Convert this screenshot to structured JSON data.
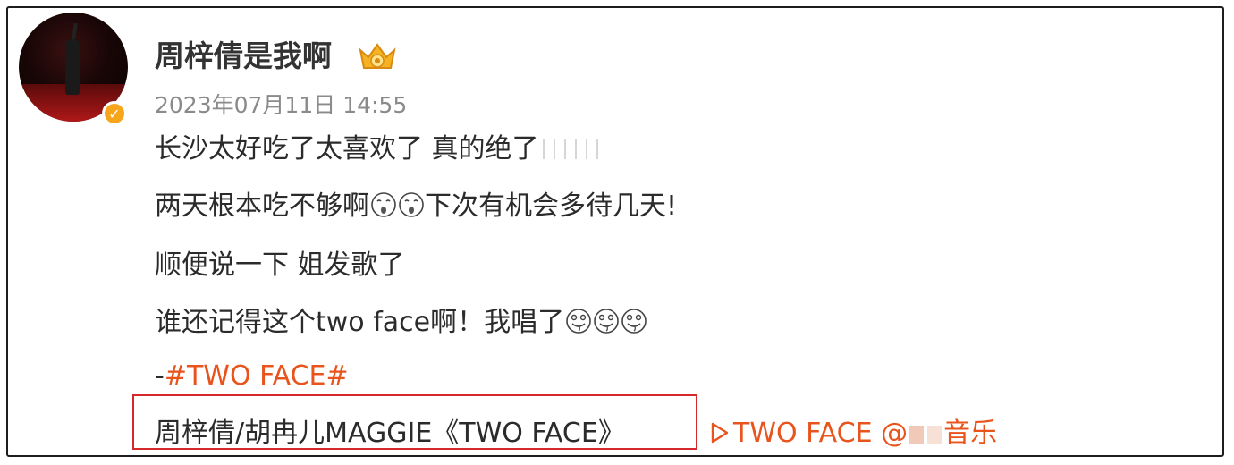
{
  "post": {
    "username": "周梓倩是我啊",
    "timestamp": "2023年07月11日 14:55",
    "lines": [
      "长沙太好吃了太喜欢了 真的绝了",
      "两天根本吃不够啊",
      "下次有机会多待几天!",
      "顺便说一下 姐发歌了",
      "谁还记得这个two face啊！我唱了",
      "-",
      "#TWO FACE#"
    ],
    "music": {
      "title": "周梓倩/胡冉儿MAGGIE《TWO FACE》",
      "link_text": "TWO FACE @",
      "link_suffix": "音乐"
    }
  },
  "colors": {
    "accent": "#e8541c",
    "highlight_box": "#d4282a",
    "verified": "#f7a61c",
    "timestamp": "#8a8a8a"
  },
  "icons": {
    "verified": "verified-badge-icon",
    "crown": "vip-crown-icon",
    "emoji_sad": "crying-emoji-icon",
    "emoji_drool": "drooling-emoji-icon",
    "play": "play-triangle-icon"
  }
}
